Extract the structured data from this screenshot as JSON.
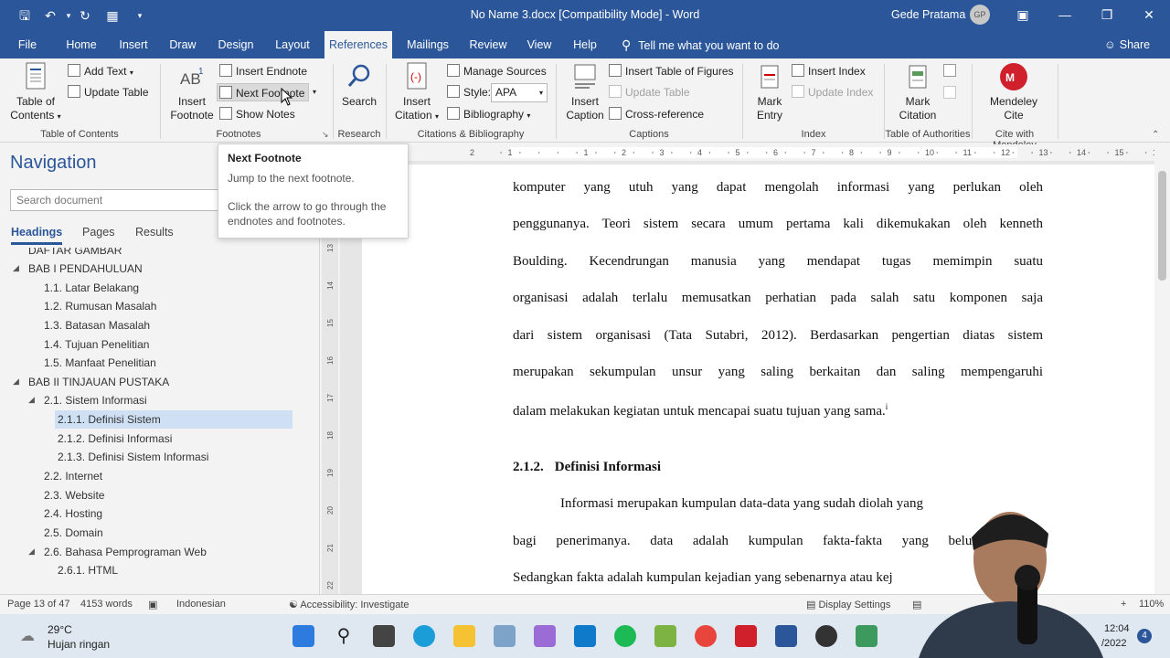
{
  "titlebar": {
    "doc_title": "No Name 3.docx [Compatibility Mode] - Word",
    "user_name": "Gede Pratama",
    "user_initials": "GP"
  },
  "tabs": [
    "File",
    "Home",
    "Insert",
    "Draw",
    "Design",
    "Layout",
    "References",
    "Mailings",
    "Review",
    "View",
    "Help"
  ],
  "active_tab": "References",
  "tell_me": "Tell me what you want to do",
  "share": "Share",
  "ribbon": {
    "toc": {
      "label_line1": "Table of",
      "label_line2": "Contents",
      "add_text": "Add Text",
      "update_table": "Update Table",
      "group": "Table of Contents"
    },
    "footnotes": {
      "insert_line1": "Insert",
      "insert_line2": "Footnote",
      "insert_endnote": "Insert Endnote",
      "next_footnote": "Next Footnote",
      "show_notes": "Show Notes",
      "group": "Footnotes"
    },
    "research": {
      "search": "Search",
      "group": "Research"
    },
    "citations": {
      "insert_line1": "Insert",
      "insert_line2": "Citation",
      "manage_sources": "Manage Sources",
      "style_label": "Style:",
      "style_value": "APA",
      "bibliography": "Bibliography",
      "group": "Citations & Bibliography"
    },
    "captions": {
      "insert_line1": "Insert",
      "insert_line2": "Caption",
      "insert_tof": "Insert Table of Figures",
      "update_table": "Update Table",
      "cross_ref": "Cross-reference",
      "group": "Captions"
    },
    "index": {
      "mark_line1": "Mark",
      "mark_line2": "Entry",
      "insert_index": "Insert Index",
      "update_index": "Update Index",
      "group": "Index"
    },
    "toa": {
      "mark_line1": "Mark",
      "mark_line2": "Citation",
      "group": "Table of Authorities"
    },
    "mendeley": {
      "line1": "Mendeley",
      "line2": "Cite",
      "group": "Cite with Mendeley"
    }
  },
  "tooltip": {
    "title": "Next Footnote",
    "desc": "Jump to the next footnote.",
    "hint": "Click the arrow to go through the endnotes and footnotes."
  },
  "nav": {
    "title": "Navigation",
    "search_placeholder": "Search document",
    "tabs": [
      "Headings",
      "Pages",
      "Results"
    ],
    "headings": [
      "DAFTAR GAMBAR",
      "BAB I PENDAHULUAN",
      "1.1. Latar Belakang",
      "1.2. Rumusan Masalah",
      "1.3. Batasan Masalah",
      "1.4. Tujuan Penelitian",
      "1.5. Manfaat Penelitian",
      "BAB II TINJAUAN PUSTAKA",
      "2.1. Sistem Informasi",
      "2.1.1. Definisi Sistem",
      "2.1.2. Definisi Informasi",
      "2.1.3. Definisi Sistem Informasi",
      "2.2. Internet",
      "2.3. Website",
      "2.4. Hosting",
      "2.5. Domain",
      "2.6. Bahasa Pemprograman Web",
      "2.6.1. HTML"
    ]
  },
  "document": {
    "lines": [
      "komputer yang utuh yang dapat mengolah informasi yang perlukan oleh",
      "penggunanya. Teori sistem secara umum pertama kali dikemukakan oleh kenneth",
      "Boulding. Kecendrungan manusia yang mendapat tugas memimpin suatu",
      "organisasi adalah terlalu memusatkan perhatian pada salah satu komponen saja",
      "dari sistem organisasi (Tata Sutabri, 2012). Berdasarkan pengertian diatas sistem",
      "merupakan sekumpulan unsur yang saling berkaitan dan saling mempengaruhi",
      "dalam melakukan kegiatan untuk mencapai suatu tujuan yang sama."
    ],
    "footnote_mark": "i",
    "subheading_num": "2.1.2.",
    "subheading_text": "Definisi Informasi",
    "lines2": [
      "Informasi merupakan kumpulan data-data yang sudah diolah yang",
      "bagi penerimanya. data adalah kumpulan fakta-fakta yang belum",
      "Sedangkan fakta adalah kumpulan kejadian yang sebenarnya atau kej"
    ]
  },
  "status": {
    "page": "Page 13 of 47",
    "words": "4153 words",
    "language": "Indonesian",
    "accessibility": "Accessibility: Investigate",
    "display_settings": "Display Settings",
    "zoom": "110%"
  },
  "taskbar": {
    "temp": "29°C",
    "weather": "Hujan ringan",
    "time": "12:04",
    "date": "/2022",
    "notif_count": "4"
  }
}
